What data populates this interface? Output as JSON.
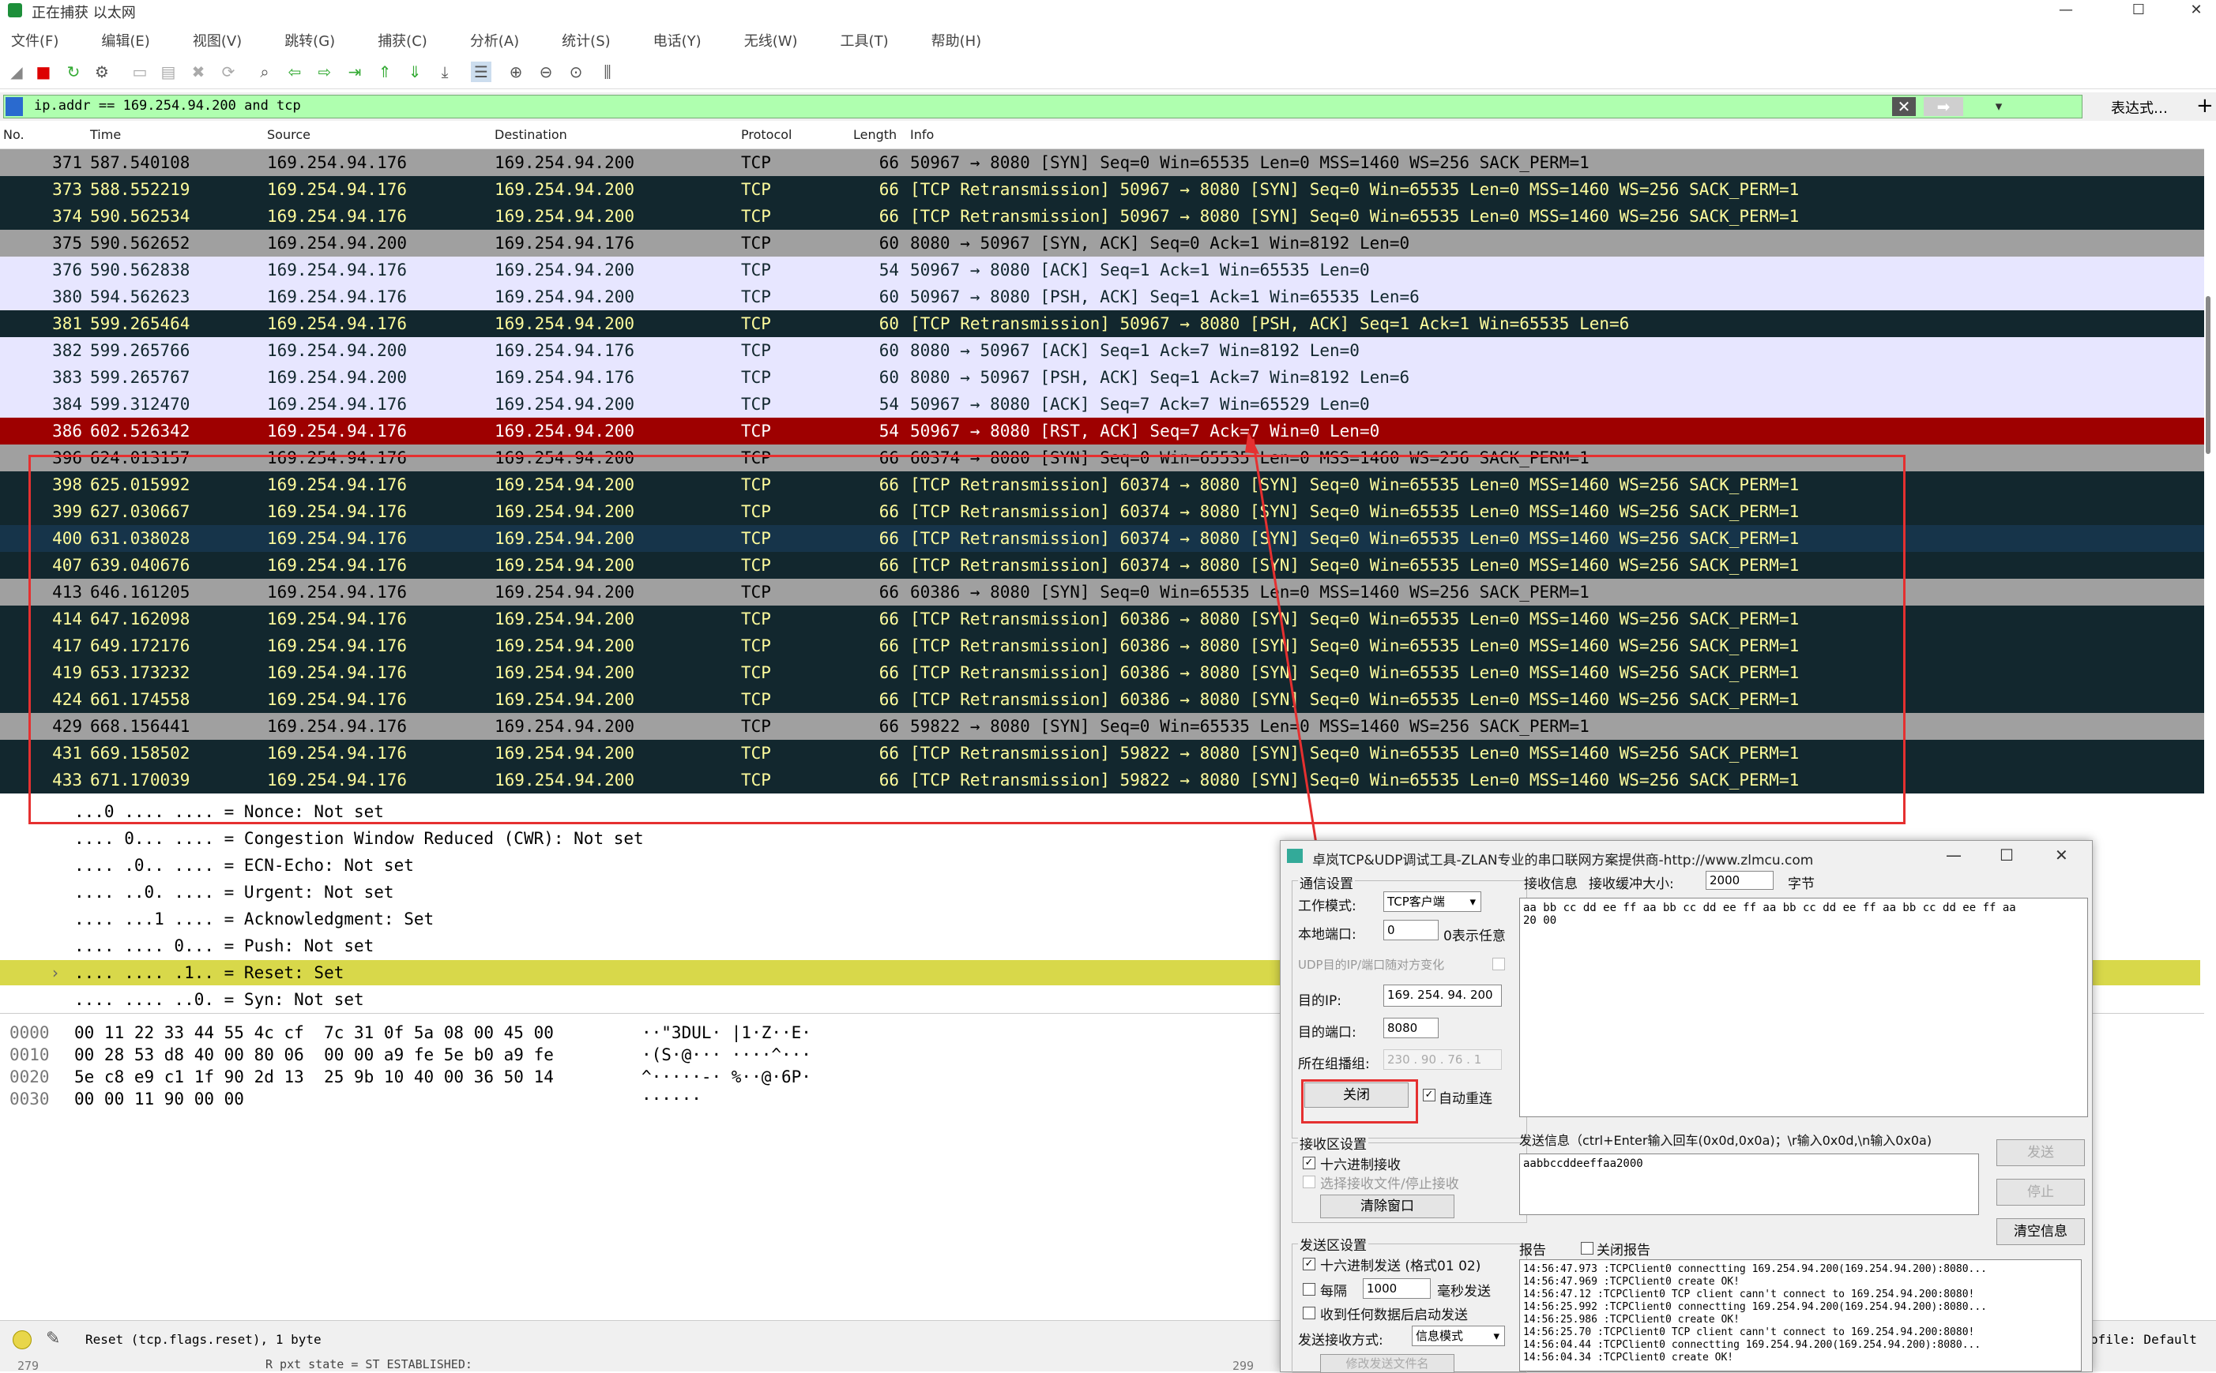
{
  "window": {
    "title": "正在捕获 以太网",
    "minimize": "—",
    "maximize": "☐",
    "close": "✕"
  },
  "menu": [
    "文件(F)",
    "编辑(E)",
    "视图(V)",
    "跳转(G)",
    "捕获(C)",
    "分析(A)",
    "统计(S)",
    "电话(Y)",
    "无线(W)",
    "工具(T)",
    "帮助(H)"
  ],
  "filter": {
    "value": "ip.addr == 169.254.94.200 and tcp",
    "expression_label": "表达式…",
    "plus": "+"
  },
  "columns": {
    "no": "No.",
    "time": "Time",
    "source": "Source",
    "destination": "Destination",
    "protocol": "Protocol",
    "length": "Length",
    "info": "Info"
  },
  "packets": [
    {
      "no": "371",
      "time": "587.540108",
      "src": "169.254.94.176",
      "dst": "169.254.94.200",
      "proto": "TCP",
      "len": "66",
      "info": "50967 → 8080 [SYN] Seq=0 Win=65535 Len=0 MSS=1460 WS=256 SACK_PERM=1",
      "style": "gray"
    },
    {
      "no": "373",
      "time": "588.552219",
      "src": "169.254.94.176",
      "dst": "169.254.94.200",
      "proto": "TCP",
      "len": "66",
      "info": "[TCP Retransmission] 50967 → 8080 [SYN] Seq=0 Win=65535 Len=0 MSS=1460 WS=256 SACK_PERM=1",
      "style": "dark"
    },
    {
      "no": "374",
      "time": "590.562534",
      "src": "169.254.94.176",
      "dst": "169.254.94.200",
      "proto": "TCP",
      "len": "66",
      "info": "[TCP Retransmission] 50967 → 8080 [SYN] Seq=0 Win=65535 Len=0 MSS=1460 WS=256 SACK_PERM=1",
      "style": "dark"
    },
    {
      "no": "375",
      "time": "590.562652",
      "src": "169.254.94.200",
      "dst": "169.254.94.176",
      "proto": "TCP",
      "len": "60",
      "info": "8080 → 50967 [SYN, ACK] Seq=0 Ack=1 Win=8192 Len=0",
      "style": "gray"
    },
    {
      "no": "376",
      "time": "590.562838",
      "src": "169.254.94.176",
      "dst": "169.254.94.200",
      "proto": "TCP",
      "len": "54",
      "info": "50967 → 8080 [ACK] Seq=1 Ack=1 Win=65535 Len=0",
      "style": "light"
    },
    {
      "no": "380",
      "time": "594.562623",
      "src": "169.254.94.176",
      "dst": "169.254.94.200",
      "proto": "TCP",
      "len": "60",
      "info": "50967 → 8080 [PSH, ACK] Seq=1 Ack=1 Win=65535 Len=6",
      "style": "light"
    },
    {
      "no": "381",
      "time": "599.265464",
      "src": "169.254.94.176",
      "dst": "169.254.94.200",
      "proto": "TCP",
      "len": "60",
      "info": "[TCP Retransmission] 50967 → 8080 [PSH, ACK] Seq=1 Ack=1 Win=65535 Len=6",
      "style": "dark"
    },
    {
      "no": "382",
      "time": "599.265766",
      "src": "169.254.94.200",
      "dst": "169.254.94.176",
      "proto": "TCP",
      "len": "60",
      "info": "8080 → 50967 [ACK] Seq=1 Ack=7 Win=8192 Len=0",
      "style": "light"
    },
    {
      "no": "383",
      "time": "599.265767",
      "src": "169.254.94.200",
      "dst": "169.254.94.176",
      "proto": "TCP",
      "len": "60",
      "info": "8080 → 50967 [PSH, ACK] Seq=1 Ack=7 Win=8192 Len=6",
      "style": "light"
    },
    {
      "no": "384",
      "time": "599.312470",
      "src": "169.254.94.176",
      "dst": "169.254.94.200",
      "proto": "TCP",
      "len": "54",
      "info": "50967 → 8080 [ACK] Seq=7 Ack=7 Win=65529 Len=0",
      "style": "light"
    },
    {
      "no": "386",
      "time": "602.526342",
      "src": "169.254.94.176",
      "dst": "169.254.94.200",
      "proto": "TCP",
      "len": "54",
      "info": "50967 → 8080 [RST, ACK] Seq=7 Ack=7 Win=0 Len=0",
      "style": "sel"
    },
    {
      "no": "396",
      "time": "624.013157",
      "src": "169.254.94.176",
      "dst": "169.254.94.200",
      "proto": "TCP",
      "len": "66",
      "info": "60374 → 8080 [SYN] Seq=0 Win=65535 Len=0 MSS=1460 WS=256 SACK_PERM=1",
      "style": "gray"
    },
    {
      "no": "398",
      "time": "625.015992",
      "src": "169.254.94.176",
      "dst": "169.254.94.200",
      "proto": "TCP",
      "len": "66",
      "info": "[TCP Retransmission] 60374 → 8080 [SYN] Seq=0 Win=65535 Len=0 MSS=1460 WS=256 SACK_PERM=1",
      "style": "dark"
    },
    {
      "no": "399",
      "time": "627.030667",
      "src": "169.254.94.176",
      "dst": "169.254.94.200",
      "proto": "TCP",
      "len": "66",
      "info": "[TCP Retransmission] 60374 → 8080 [SYN] Seq=0 Win=65535 Len=0 MSS=1460 WS=256 SACK_PERM=1",
      "style": "dark"
    },
    {
      "no": "400",
      "time": "631.038028",
      "src": "169.254.94.176",
      "dst": "169.254.94.200",
      "proto": "TCP",
      "len": "66",
      "info": "[TCP Retransmission] 60374 → 8080 [SYN] Seq=0 Win=65535 Len=0 MSS=1460 WS=256 SACK_PERM=1",
      "style": "dark2"
    },
    {
      "no": "407",
      "time": "639.040676",
      "src": "169.254.94.176",
      "dst": "169.254.94.200",
      "proto": "TCP",
      "len": "66",
      "info": "[TCP Retransmission] 60374 → 8080 [SYN] Seq=0 Win=65535 Len=0 MSS=1460 WS=256 SACK_PERM=1",
      "style": "dark"
    },
    {
      "no": "413",
      "time": "646.161205",
      "src": "169.254.94.176",
      "dst": "169.254.94.200",
      "proto": "TCP",
      "len": "66",
      "info": "60386 → 8080 [SYN] Seq=0 Win=65535 Len=0 MSS=1460 WS=256 SACK_PERM=1",
      "style": "gray"
    },
    {
      "no": "414",
      "time": "647.162098",
      "src": "169.254.94.176",
      "dst": "169.254.94.200",
      "proto": "TCP",
      "len": "66",
      "info": "[TCP Retransmission] 60386 → 8080 [SYN] Seq=0 Win=65535 Len=0 MSS=1460 WS=256 SACK_PERM=1",
      "style": "dark"
    },
    {
      "no": "417",
      "time": "649.172176",
      "src": "169.254.94.176",
      "dst": "169.254.94.200",
      "proto": "TCP",
      "len": "66",
      "info": "[TCP Retransmission] 60386 → 8080 [SYN] Seq=0 Win=65535 Len=0 MSS=1460 WS=256 SACK_PERM=1",
      "style": "dark"
    },
    {
      "no": "419",
      "time": "653.173232",
      "src": "169.254.94.176",
      "dst": "169.254.94.200",
      "proto": "TCP",
      "len": "66",
      "info": "[TCP Retransmission] 60386 → 8080 [SYN] Seq=0 Win=65535 Len=0 MSS=1460 WS=256 SACK_PERM=1",
      "style": "dark"
    },
    {
      "no": "424",
      "time": "661.174558",
      "src": "169.254.94.176",
      "dst": "169.254.94.200",
      "proto": "TCP",
      "len": "66",
      "info": "[TCP Retransmission] 60386 → 8080 [SYN] Seq=0 Win=65535 Len=0 MSS=1460 WS=256 SACK_PERM=1",
      "style": "dark"
    },
    {
      "no": "429",
      "time": "668.156441",
      "src": "169.254.94.176",
      "dst": "169.254.94.200",
      "proto": "TCP",
      "len": "66",
      "info": "59822 → 8080 [SYN] Seq=0 Win=65535 Len=0 MSS=1460 WS=256 SACK_PERM=1",
      "style": "gray"
    },
    {
      "no": "431",
      "time": "669.158502",
      "src": "169.254.94.176",
      "dst": "169.254.94.200",
      "proto": "TCP",
      "len": "66",
      "info": "[TCP Retransmission] 59822 → 8080 [SYN] Seq=0 Win=65535 Len=0 MSS=1460 WS=256 SACK_PERM=1",
      "style": "dark"
    },
    {
      "no": "433",
      "time": "671.170039",
      "src": "169.254.94.176",
      "dst": "169.254.94.200",
      "proto": "TCP",
      "len": "66",
      "info": "[TCP Retransmission] 59822 → 8080 [SYN] Seq=0 Win=65535 Len=0 MSS=1460 WS=256 SACK_PERM=1",
      "style": "dark"
    }
  ],
  "details": [
    "...0 .... .... = Nonce: Not set",
    ".... 0... .... = Congestion Window Reduced (CWR): Not set",
    ".... .0.. .... = ECN-Echo: Not set",
    ".... ..0. .... = Urgent: Not set",
    ".... ...1 .... = Acknowledgment: Set",
    ".... .... 0... = Push: Not set",
    ".... .... .1.. = Reset: Set",
    ".... .... ..0. = Syn: Not set"
  ],
  "details_selected_index": 6,
  "expand_marker": "›",
  "hex": [
    {
      "offset": "0000",
      "bytes": "00 11 22 33 44 55 4c cf  7c 31 0f 5a 08 00 45 00",
      "ascii": "··\"3DUL· |1·Z··E·"
    },
    {
      "offset": "0010",
      "bytes": "00 28 53 d8 40 00 80 06  00 00 a9 fe 5e b0 a9 fe",
      "ascii": "·(S·@··· ····^···"
    },
    {
      "offset": "0020",
      "bytes": "5e c8 e9 c1 1f 90 2d 13  25 9b 10 40 00 36 50 14",
      "ascii": "^·····-· %··@·6P·"
    },
    {
      "offset": "0030",
      "bytes": "00 00 11 90 00 00",
      "ascii": "······"
    }
  ],
  "status": {
    "text": "Reset (tcp.flags.reset), 1 byte",
    "profile": "ofile: Default",
    "bottom_left": "279",
    "bottom_mid": "R pxt state = ST ESTABLISHED:",
    "bottom_right": "299"
  },
  "tool": {
    "title": "卓岚TCP&UDP调试工具-ZLAN专业的串口联网方案提供商-http://www.zlmcu.com",
    "comm_group": "通信设置",
    "mode_label": "工作模式:",
    "mode_value": "TCP客户端",
    "local_port_label": "本地端口:",
    "local_port_value": "0",
    "local_port_hint": "0表示任意",
    "udp_follow_label": "UDP目的IP/端口随对方变化",
    "dest_ip_label": "目的IP:",
    "dest_ip_value": "169. 254. 94. 200",
    "dest_port_label": "目的端口:",
    "dest_port_value": "8080",
    "mcast_label": "所在组播组:",
    "mcast_value": "230 . 90 . 76 . 1",
    "close_button": "关闭",
    "auto_reconnect": "自动重连",
    "recv_info_label": "接收信息",
    "recv_buf_label": "接收缓冲大小:",
    "recv_buf_value": "2000",
    "recv_buf_unit": "字节",
    "recv_text": "aa bb cc dd ee ff aa bb cc dd ee ff aa bb cc dd ee ff aa bb cc dd ee ff aa\n20 00",
    "recv_area_group": "接收区设置",
    "hex_recv": "十六进制接收",
    "select_recv_file": "选择接收文件/停止接收",
    "clear_window": "清除窗口",
    "send_info_label": "发送信息（ctrl+Enter输入回车(0x0d,0x0a)；\\r输入0x0d,\\n输入0x0a)",
    "send_text": "aabbccddeeffaa2000",
    "send_button": "发送",
    "stop_button": "停止",
    "clear_info_button": "清空信息",
    "send_area_group": "发送区设置",
    "hex_send": "十六进制发送 (格式01 02)",
    "every_label": "每隔",
    "every_value": "1000",
    "ms_send": "毫秒发送",
    "auto_send_label": "收到任何数据后启动发送",
    "send_recv_mode_label": "发送接收方式:",
    "send_recv_mode_value": "信息模式",
    "modify_file": "修改发送文件名",
    "report_label": "报告",
    "close_report": "关闭报告",
    "report_text": "14:56:47.973 :TCPClient0 connectting 169.254.94.200(169.254.94.200):8080...\n14:56:47.969 :TCPClient0 create OK!\n14:56:47.12 :TCPClient0 TCP client cann't connect to 169.254.94.200:8080!\n14:56:25.992 :TCPClient0 connectting 169.254.94.200(169.254.94.200):8080...\n14:56:25.986 :TCPClient0 create OK!\n14:56:25.70 :TCPClient0 TCP client cann't connect to 169.254.94.200:8080!\n14:56:04.44 :TCPClient0 connectting 169.254.94.200(169.254.94.200):8080...\n14:56:04.34 :TCPClient0 create OK!"
  },
  "colors": {
    "highlight": "#e53030",
    "selected_row": "#9e0000",
    "filter_ok": "#afffaf"
  }
}
